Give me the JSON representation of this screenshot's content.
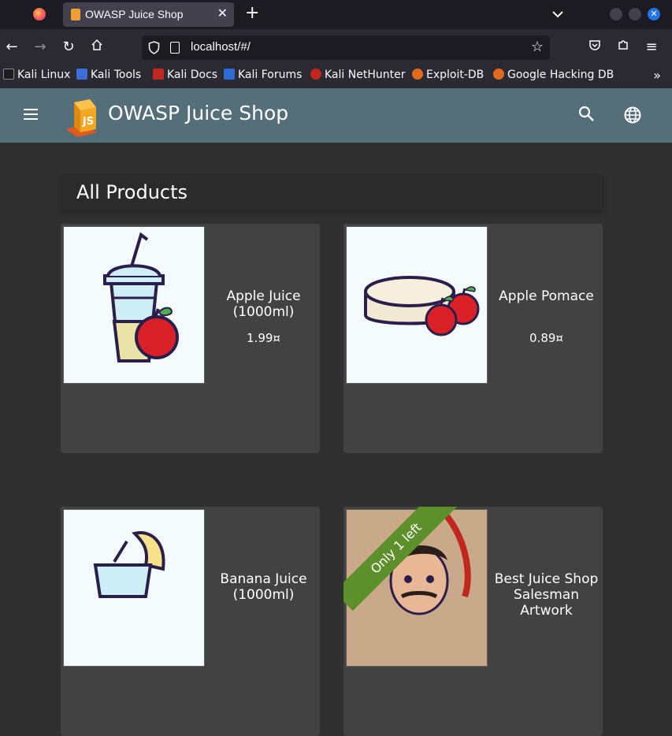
{
  "browser": {
    "tab_title": "OWASP Juice Shop",
    "tab_close": "✕",
    "new_tab": "+",
    "tab_list": "⌄",
    "url": "localhost/#/",
    "bookmarks": [
      {
        "label": "Kali Linux",
        "icon_color": "#1c1c1c"
      },
      {
        "label": "Kali Tools",
        "icon_color": "#3a6fd8"
      },
      {
        "label": "Kali Docs",
        "icon_color": "#c0281f"
      },
      {
        "label": "Kali Forums",
        "icon_color": "#2d6bd6"
      },
      {
        "label": "Kali NetHunter",
        "icon_color": "#c0281f"
      },
      {
        "label": "Exploit-DB",
        "icon_color": "#e06a1e"
      },
      {
        "label": "Google Hacking DB",
        "icon_color": "#e06a1e"
      }
    ],
    "more_bookmarks": "»"
  },
  "app": {
    "title": "OWASP Juice Shop",
    "accent": "#546e7a",
    "icons": [
      "menu-icon",
      "search-icon",
      "language-icon"
    ]
  },
  "main": {
    "heading": "All Products",
    "products": [
      {
        "name": "Apple Juice (1000ml)",
        "price": "1.99¤"
      },
      {
        "name": "Apple Pomace",
        "price": "0.89¤"
      },
      {
        "name": "Banana Juice (1000ml)",
        "price": ""
      },
      {
        "name": "Best Juice Shop Salesman Artwork",
        "price": "",
        "ribbon": "Only 1 left"
      }
    ]
  }
}
